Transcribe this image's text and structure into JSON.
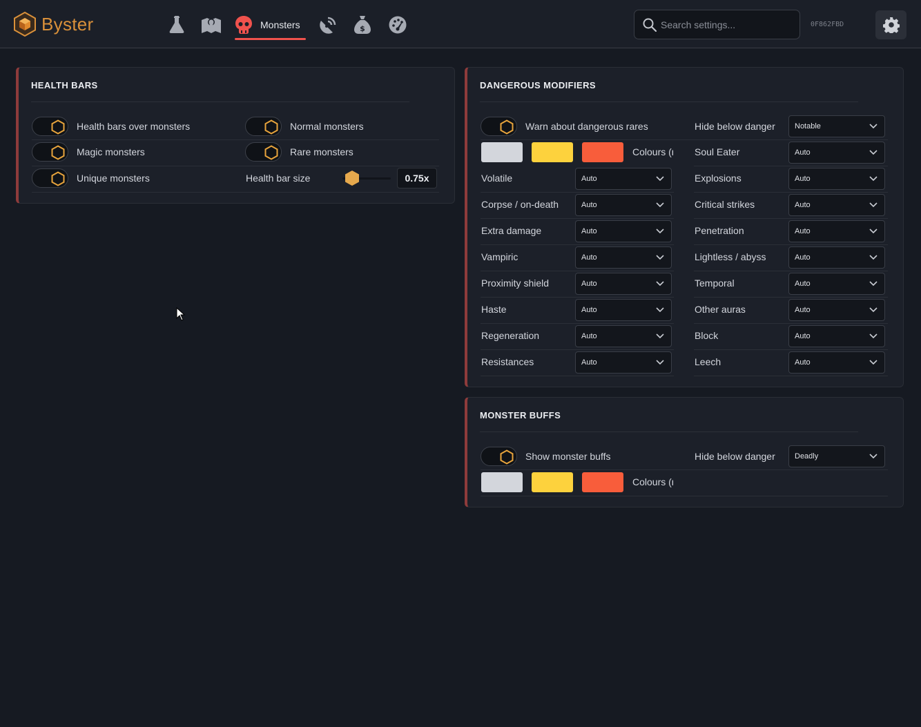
{
  "app": {
    "name": "Byster",
    "hwid": "0F862FBD",
    "accent": "#d9903a"
  },
  "nav": {
    "active_tab": "Monsters",
    "icons": [
      "flask-icon",
      "map-icon",
      "skull-icon",
      "radar-icon",
      "money-bag-icon",
      "gauge-icon"
    ]
  },
  "search": {
    "placeholder": "Search settings..."
  },
  "health_bars": {
    "title": "HEALTH BARS",
    "toggles": {
      "over_monsters": "Health bars over monsters",
      "normal": "Normal monsters",
      "magic": "Magic monsters",
      "rare": "Rare monsters",
      "unique": "Unique monsters"
    },
    "size_label": "Health bar size",
    "size_value": "0.75x",
    "slider_fraction": 0.2
  },
  "dangerous_modifiers": {
    "title": "DANGEROUS MODIFIERS",
    "warn_label": "Warn about dangerous rares",
    "hide_label": "Hide below danger",
    "hide_value": "Notable",
    "colours_label": "Colours (r",
    "colours": [
      "#d3d6dc",
      "#fdd23d",
      "#f85d3b"
    ],
    "left": [
      {
        "label": "Volatile",
        "value": "Auto"
      },
      {
        "label": "Corpse / on-death",
        "value": "Auto"
      },
      {
        "label": "Extra damage",
        "value": "Auto"
      },
      {
        "label": "Vampiric",
        "value": "Auto"
      },
      {
        "label": "Proximity shield",
        "value": "Auto"
      },
      {
        "label": "Haste",
        "value": "Auto"
      },
      {
        "label": "Regeneration",
        "value": "Auto"
      },
      {
        "label": "Resistances",
        "value": "Auto"
      }
    ],
    "right": [
      {
        "label": "Soul Eater",
        "value": "Auto"
      },
      {
        "label": "Explosions",
        "value": "Auto"
      },
      {
        "label": "Critical strikes",
        "value": "Auto"
      },
      {
        "label": "Penetration",
        "value": "Auto"
      },
      {
        "label": "Lightless / abyss",
        "value": "Auto"
      },
      {
        "label": "Temporal",
        "value": "Auto"
      },
      {
        "label": "Other auras",
        "value": "Auto"
      },
      {
        "label": "Block",
        "value": "Auto"
      },
      {
        "label": "Leech",
        "value": "Auto"
      }
    ]
  },
  "monster_buffs": {
    "title": "MONSTER BUFFS",
    "show_label": "Show monster buffs",
    "hide_label": "Hide below danger",
    "hide_value": "Deadly",
    "colours_label": "Colours (r",
    "colours": [
      "#d3d6dc",
      "#fdd23d",
      "#f85d3b"
    ]
  }
}
